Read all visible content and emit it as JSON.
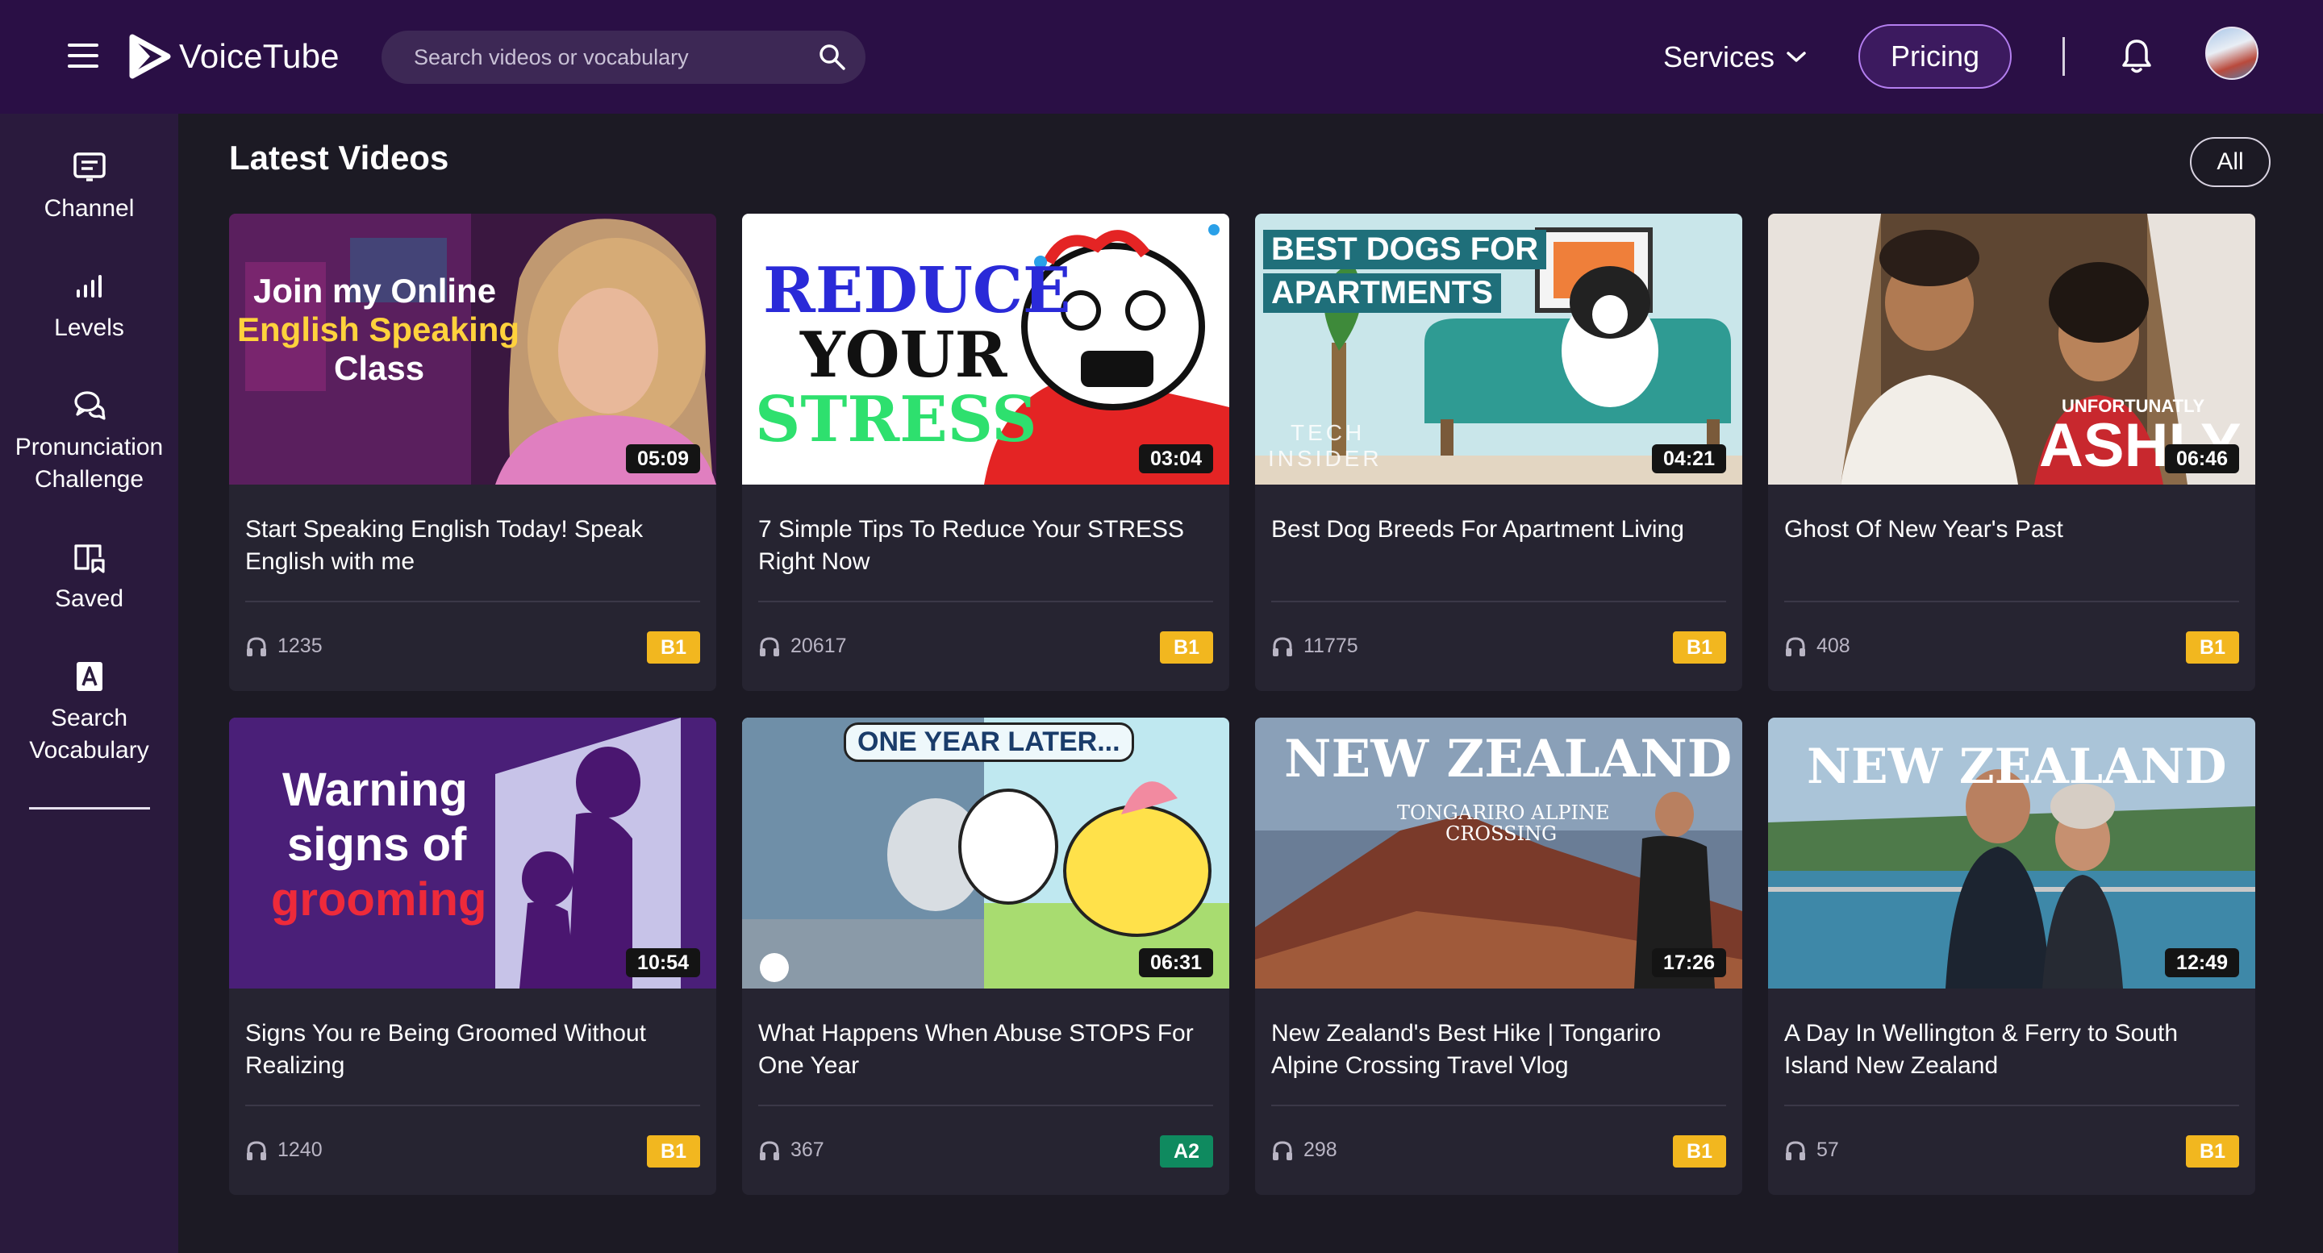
{
  "header": {
    "logo_text": "VoiceTube",
    "search_placeholder": "Search videos or vocabulary",
    "services_label": "Services",
    "pricing_label": "Pricing"
  },
  "sidebar": {
    "items": [
      {
        "label_line1": "Channel",
        "label_line2": "",
        "icon": "channel-icon"
      },
      {
        "label_line1": "Levels",
        "label_line2": "",
        "icon": "levels-icon"
      },
      {
        "label_line1": "Pronunciation",
        "label_line2": "Challenge",
        "icon": "chat-bubbles-icon"
      },
      {
        "label_line1": "Saved",
        "label_line2": "",
        "icon": "bookmark-icon"
      },
      {
        "label_line1": "Search",
        "label_line2": "Vocabulary",
        "icon": "dictionary-icon"
      }
    ]
  },
  "main": {
    "section_title": "Latest Videos",
    "all_label": "All",
    "videos": [
      {
        "title_line1": "Start Speaking English Today! Speak",
        "title_line2": "English with me",
        "duration": "05:09",
        "views": "1235",
        "level": "B1",
        "thumb_text": [
          "Join my Online",
          "English Speaking",
          "Class"
        ]
      },
      {
        "title_line1": "7 Simple Tips To Reduce Your STRESS",
        "title_line2": "Right Now",
        "duration": "03:04",
        "views": "20617",
        "level": "B1",
        "thumb_text": [
          "REDUCE",
          "YOUR",
          "STRESS"
        ]
      },
      {
        "title_line1": "Best Dog Breeds For Apartment Living",
        "title_line2": "",
        "duration": "04:21",
        "views": "11775",
        "level": "B1",
        "thumb_text": [
          "BEST DOGS FOR",
          "APARTMENTS",
          "TECH",
          "INSIDER"
        ]
      },
      {
        "title_line1": "Ghost Of New Year's Past",
        "title_line2": "",
        "duration": "06:46",
        "views": "408",
        "level": "B1",
        "thumb_text": [
          "UNFORTUNATLY",
          "ASHLY"
        ]
      },
      {
        "title_line1": "Signs You re Being Groomed Without",
        "title_line2": "Realizing",
        "duration": "10:54",
        "views": "1240",
        "level": "B1",
        "thumb_text": [
          "Warning",
          "signs of",
          "grooming"
        ]
      },
      {
        "title_line1": "What Happens When Abuse STOPS For",
        "title_line2": "One Year",
        "duration": "06:31",
        "views": "367",
        "level": "A2",
        "thumb_text": [
          "ONE YEAR LATER..."
        ]
      },
      {
        "title_line1": "New Zealand's Best Hike | Tongariro",
        "title_line2": "Alpine Crossing Travel Vlog",
        "duration": "17:26",
        "views": "298",
        "level": "B1",
        "thumb_text": [
          "NEW ZEALAND",
          "TONGARIRO ALPINE",
          "CROSSING"
        ]
      },
      {
        "title_line1": "A Day In Wellington & Ferry to South",
        "title_line2": "Island New Zealand",
        "duration": "12:49",
        "views": "57",
        "level": "B1",
        "thumb_text": [
          "NEW ZEALAND"
        ]
      }
    ]
  },
  "colors": {
    "header_bg": "#2a0f45",
    "sidebar_bg": "#2a1a3d",
    "page_bg": "#1c1a24",
    "card_bg": "#262431",
    "level_b1": "#f2b71f",
    "level_a2": "#0f8a5f",
    "pricing_border": "#b47ff0"
  }
}
